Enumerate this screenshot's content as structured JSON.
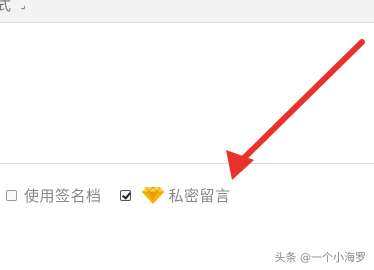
{
  "toolbar": {
    "fragment_text": "式"
  },
  "options": {
    "signature": {
      "label": "使用签名档",
      "checked": false
    },
    "private_message": {
      "label": "私密留言",
      "checked": true,
      "icon": "diamond-vip-icon"
    }
  },
  "annotation": {
    "arrow_color": "#e8322b"
  },
  "watermark": {
    "text": "头条 @一个小海罗"
  },
  "colors": {
    "toolbar_bg": "#f3f3f3",
    "label_text": "#888888",
    "gem_gold": "#f5b400"
  }
}
